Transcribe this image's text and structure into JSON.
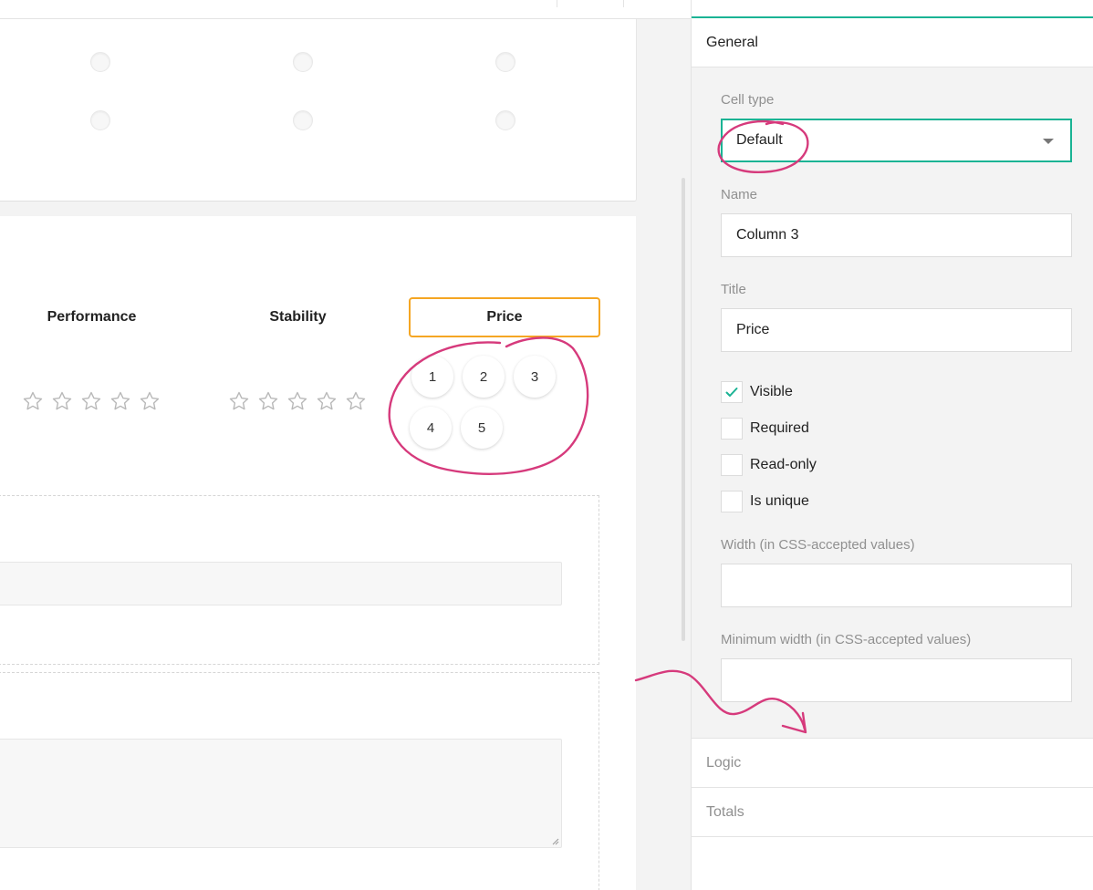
{
  "matrix": {
    "columns": [
      {
        "title": "Performance",
        "cell": "rating-stars"
      },
      {
        "title": "Stability",
        "cell": "rating-stars"
      },
      {
        "title": "Price",
        "cell": "rating-numbers",
        "selected": true
      }
    ],
    "rating_values": [
      "1",
      "2",
      "3",
      "4",
      "5"
    ]
  },
  "panel": {
    "sections": {
      "general": "General",
      "logic": "Logic",
      "totals": "Totals"
    },
    "cell_type": {
      "label": "Cell type",
      "value": "Default"
    },
    "name": {
      "label": "Name",
      "value": "Column 3"
    },
    "title": {
      "label": "Title",
      "value": "Price"
    },
    "checkboxes": [
      {
        "label": "Visible",
        "checked": true
      },
      {
        "label": "Required",
        "checked": false
      },
      {
        "label": "Read-only",
        "checked": false
      },
      {
        "label": "Is unique",
        "checked": false
      }
    ],
    "width": {
      "label": "Width (in CSS-accepted values)",
      "value": ""
    },
    "min_width": {
      "label": "Minimum width (in CSS-accepted values)",
      "value": ""
    }
  },
  "colors": {
    "accent": "#1ab394",
    "selection": "#f5a623",
    "annotation": "#d63a7c"
  }
}
